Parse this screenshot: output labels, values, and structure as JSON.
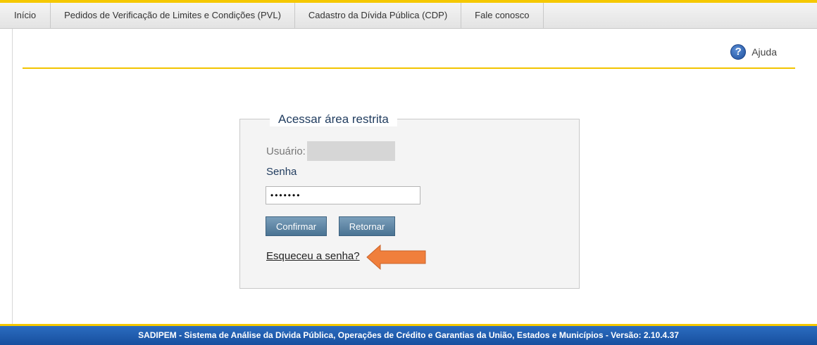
{
  "nav": {
    "items": [
      {
        "label": "Início"
      },
      {
        "label": "Pedidos de Verificação de Limites e Condições (PVL)"
      },
      {
        "label": "Cadastro da Dívida Pública (CDP)"
      },
      {
        "label": "Fale conosco"
      }
    ]
  },
  "help": {
    "label": "Ajuda",
    "icon": "question-icon",
    "icon_glyph": "?"
  },
  "login": {
    "legend": "Acessar área restrita",
    "user_label": "Usuário:",
    "password_label": "Senha",
    "password_value": "•••••••",
    "confirm_label": "Confirmar",
    "return_label": "Retornar",
    "forgot_label": "Esqueceu a senha?"
  },
  "annotation": {
    "arrow_color": "#f07f3c"
  },
  "footer": {
    "text": "SADIPEM - Sistema de Análise da Dívida Pública, Operações de Crédito e Garantias da União, Estados e Municípios - Versão: 2.10.4.37"
  },
  "colors": {
    "accent_yellow": "#f5c800",
    "footer_blue": "#1f5fb0",
    "button_blue": "#5a83a3"
  }
}
